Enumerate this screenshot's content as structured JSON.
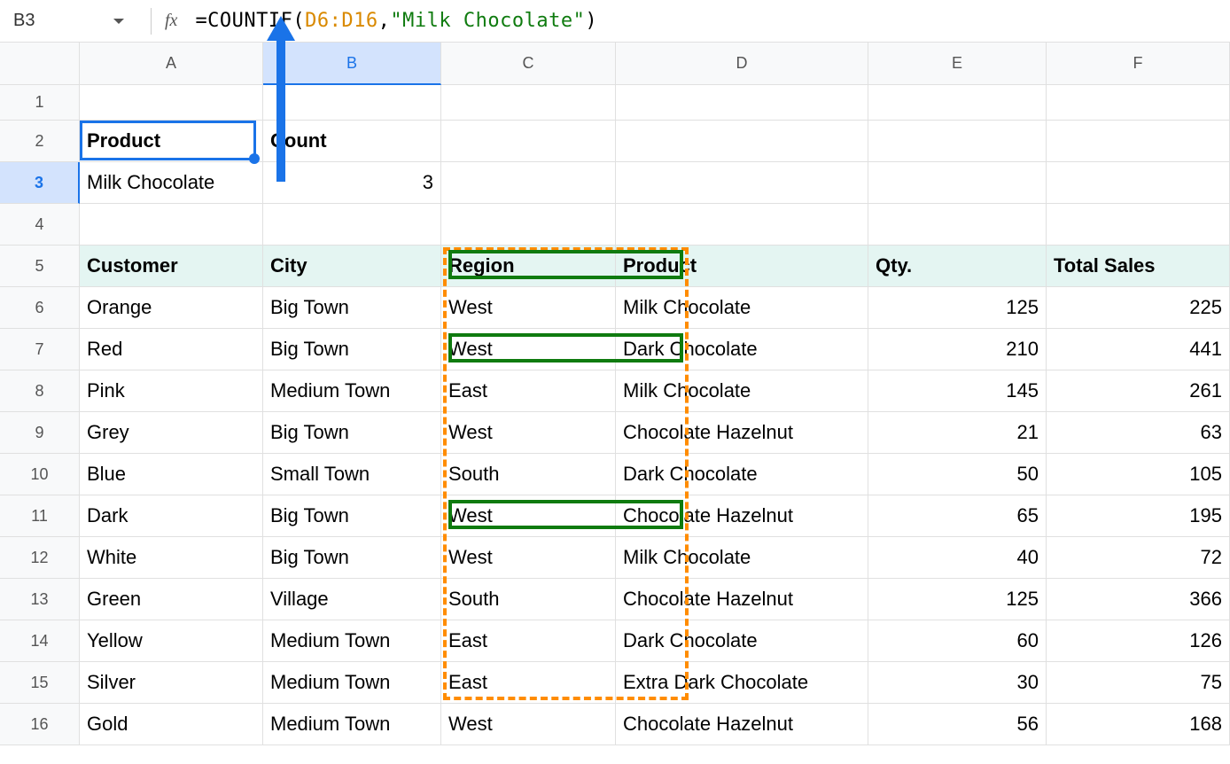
{
  "formulaBar": {
    "cellRef": "B3",
    "fx": "fx",
    "formula": {
      "p1": "=COUNTIF(",
      "range": "D6:D16",
      "comma": ",",
      "arg": "\"Milk Chocolate\"",
      "close": ")"
    }
  },
  "columns": [
    "A",
    "B",
    "C",
    "D",
    "E",
    "F"
  ],
  "rows": [
    "1",
    "2",
    "3",
    "4",
    "5",
    "6",
    "7",
    "8",
    "9",
    "10",
    "11",
    "12",
    "13",
    "14",
    "15",
    "16"
  ],
  "summary": {
    "productLabel": "Product",
    "countLabel": "Count",
    "productValue": "Milk Chocolate",
    "countValue": "3"
  },
  "table": {
    "headers": {
      "customer": "Customer",
      "city": "City",
      "region": "Region",
      "product": "Product",
      "qty": "Qty.",
      "total": "Total Sales"
    },
    "data": [
      {
        "customer": "Orange",
        "city": "Big Town",
        "region": "West",
        "product": "Milk Chocolate",
        "qty": "125",
        "total": "225",
        "match": true
      },
      {
        "customer": "Red",
        "city": "Big Town",
        "region": "West",
        "product": "Dark Chocolate",
        "qty": "210",
        "total": "441",
        "match": false
      },
      {
        "customer": "Pink",
        "city": "Medium Town",
        "region": "East",
        "product": "Milk Chocolate",
        "qty": "145",
        "total": "261",
        "match": true
      },
      {
        "customer": "Grey",
        "city": "Big Town",
        "region": "West",
        "product": "Chocolate Hazelnut",
        "qty": "21",
        "total": "63",
        "match": false
      },
      {
        "customer": "Blue",
        "city": "Small Town",
        "region": "South",
        "product": "Dark Chocolate",
        "qty": "50",
        "total": "105",
        "match": false
      },
      {
        "customer": "Dark",
        "city": "Big Town",
        "region": "West",
        "product": "Chocolate Hazelnut",
        "qty": "65",
        "total": "195",
        "match": false
      },
      {
        "customer": "White",
        "city": "Big Town",
        "region": "West",
        "product": "Milk Chocolate",
        "qty": "40",
        "total": "72",
        "match": true
      },
      {
        "customer": "Green",
        "city": "Village",
        "region": "South",
        "product": "Chocolate Hazelnut",
        "qty": "125",
        "total": "366",
        "match": false
      },
      {
        "customer": "Yellow",
        "city": "Medium Town",
        "region": "East",
        "product": "Dark Chocolate",
        "qty": "60",
        "total": "126",
        "match": false
      },
      {
        "customer": "Silver",
        "city": "Medium Town",
        "region": "East",
        "product": "Extra Dark Chocolate",
        "qty": "30",
        "total": "75",
        "match": false
      },
      {
        "customer": "Gold",
        "city": "Medium Town",
        "region": "West",
        "product": "Chocolate Hazelnut",
        "qty": "56",
        "total": "168",
        "match": false
      }
    ]
  }
}
